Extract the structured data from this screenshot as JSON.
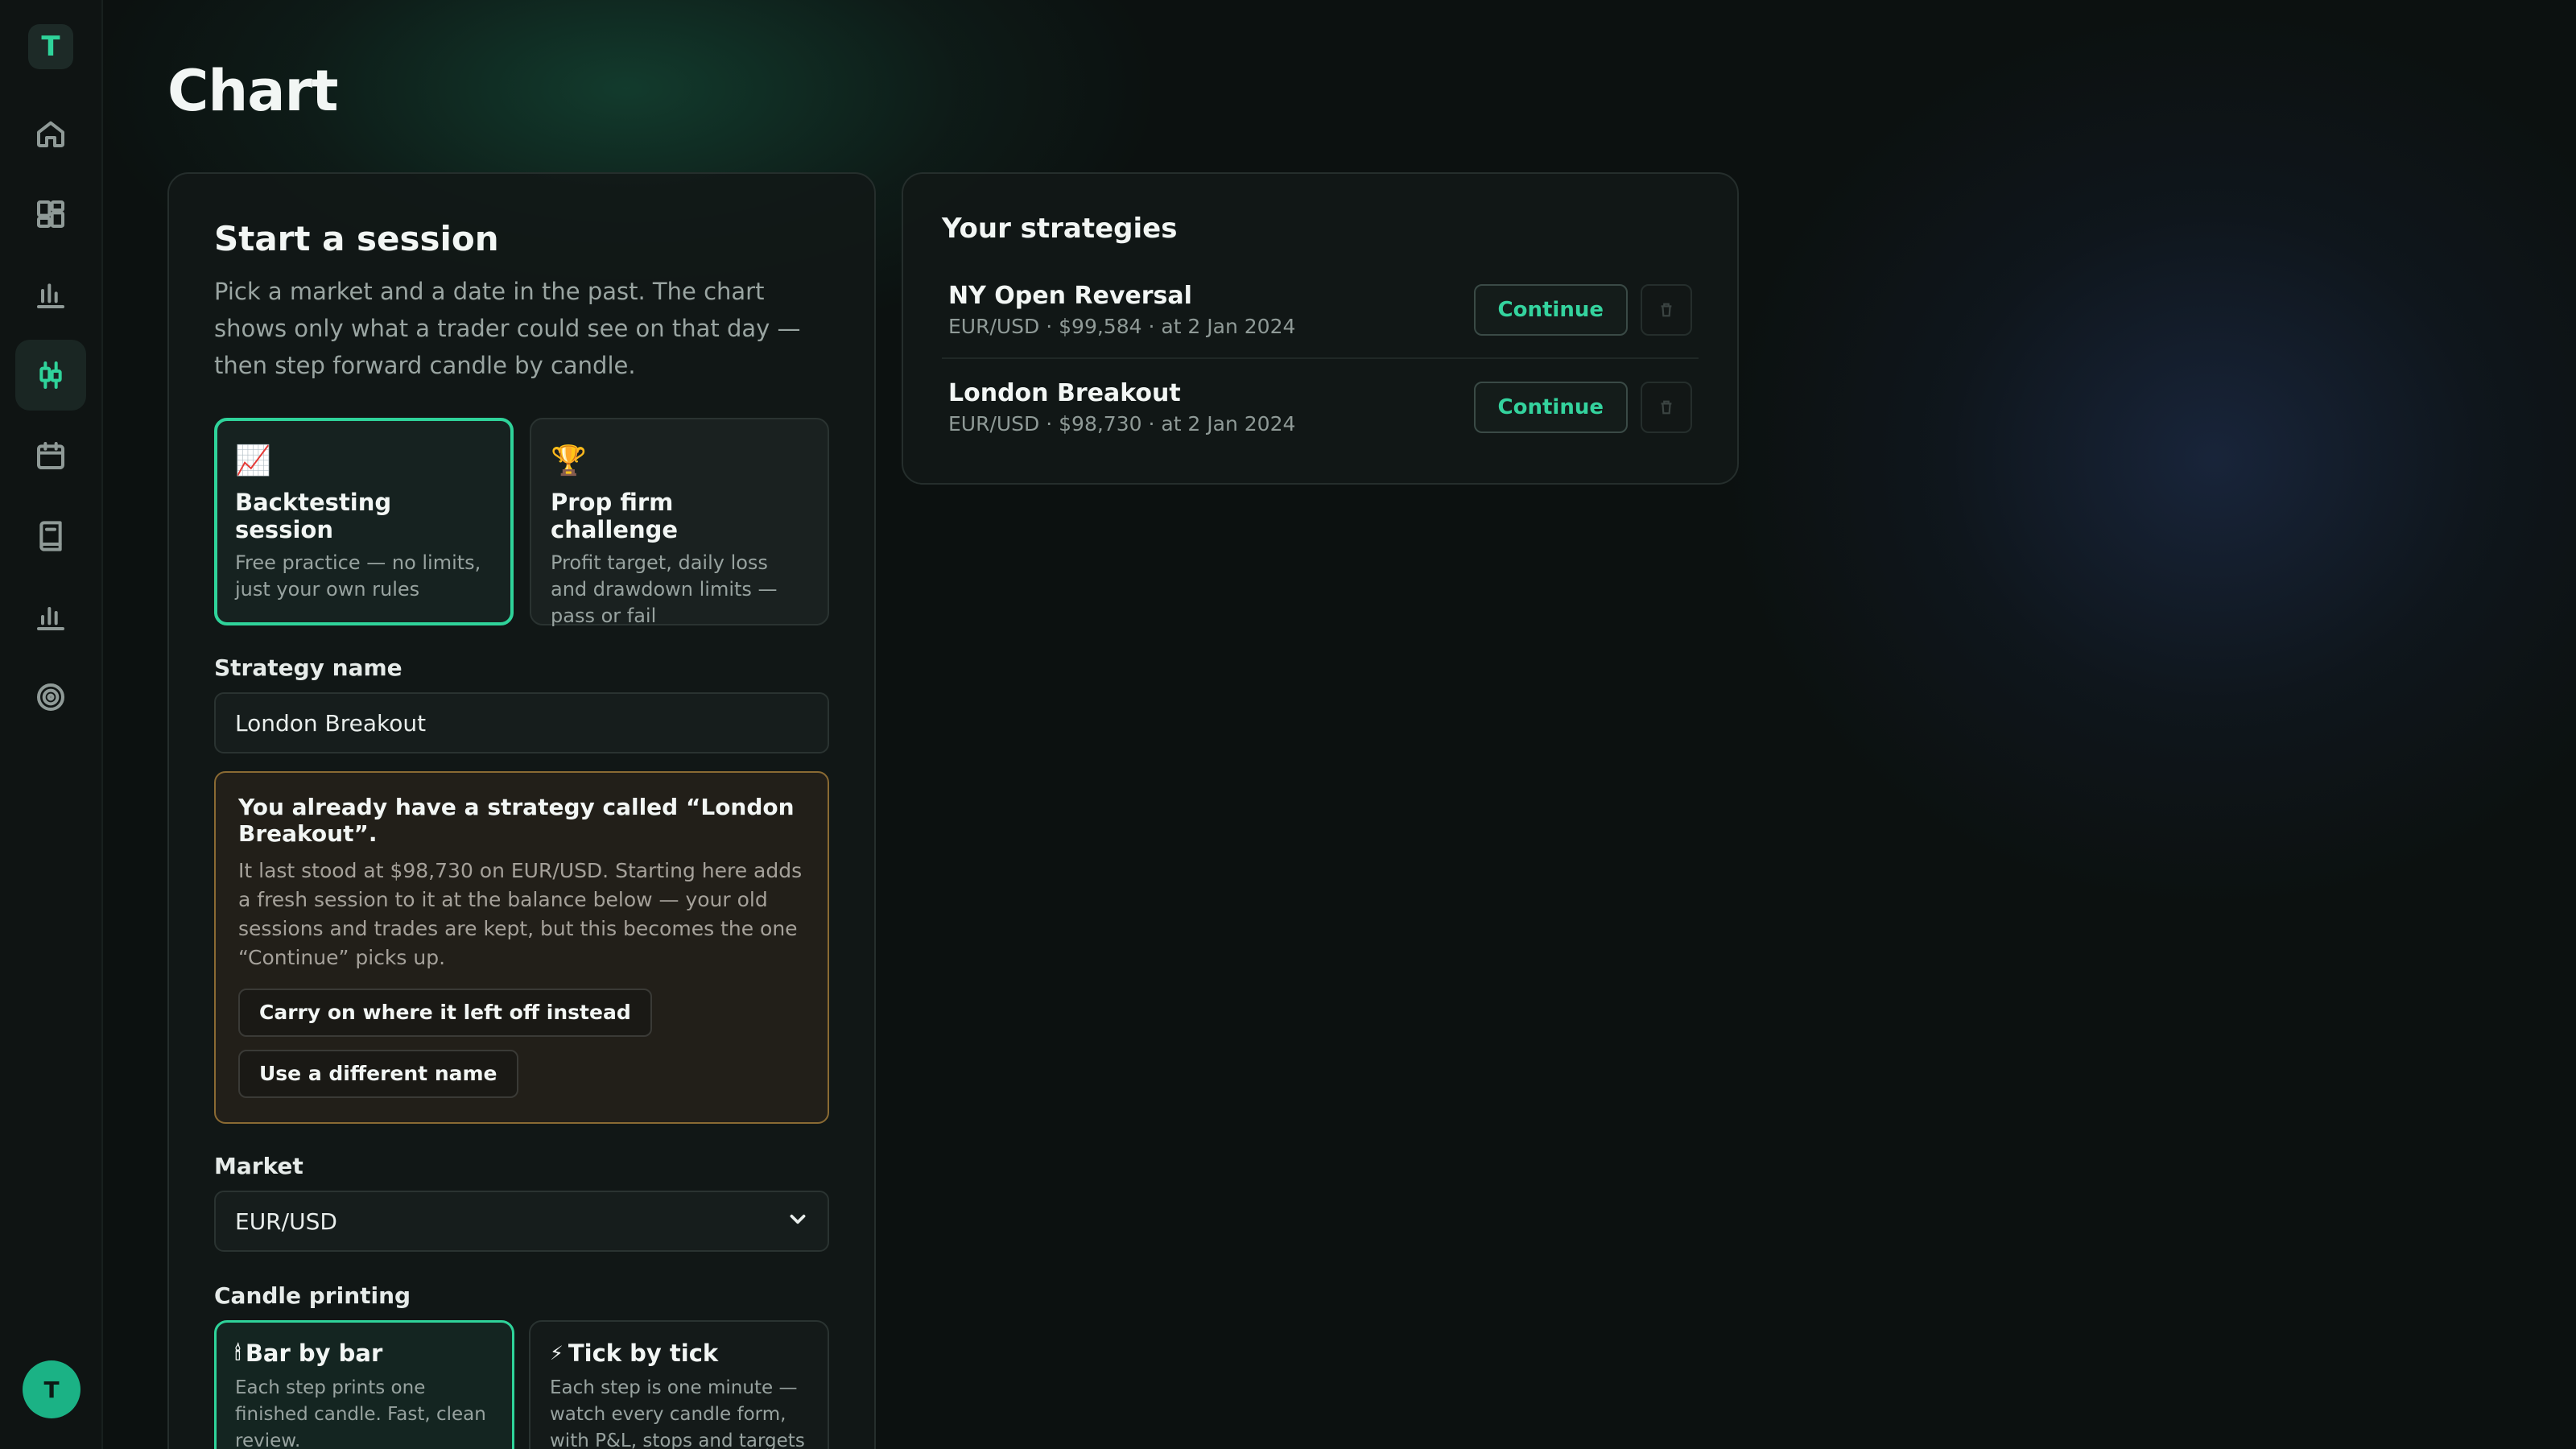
{
  "app": {
    "logo_letter": "T",
    "avatar_initial": "T"
  },
  "sidebar": {
    "items": [
      {
        "icon": "home-icon",
        "active": false
      },
      {
        "icon": "dashboard-icon",
        "active": false
      },
      {
        "icon": "bar-chart-icon",
        "active": false
      },
      {
        "icon": "candlestick-icon",
        "active": true
      },
      {
        "icon": "calendar-icon",
        "active": false
      },
      {
        "icon": "journal-icon",
        "active": false
      },
      {
        "icon": "analytics-icon",
        "active": false
      },
      {
        "icon": "target-icon",
        "active": false
      }
    ]
  },
  "page": {
    "title": "Chart"
  },
  "session": {
    "heading": "Start a session",
    "intro": "Pick a market and a date in the past. The chart shows only what a trader could see on that day — then step forward candle by candle.",
    "types": [
      {
        "icon": "📈",
        "title": "Backtesting session",
        "desc": "Free practice — no limits, just your own rules",
        "selected": true
      },
      {
        "icon": "🏆",
        "title": "Prop firm challenge",
        "desc": "Profit target, daily loss and drawdown limits — pass or fail",
        "selected": false
      }
    ],
    "strategy_label": "Strategy name",
    "strategy_value": "London Breakout",
    "warning": {
      "title": "You already have a strategy called “London Breakout”.",
      "body": "It last stood at $98,730 on EUR/USD. Starting here adds a fresh session to it at the balance below — your old sessions and trades are kept, but this becomes the one “Continue” picks up.",
      "carry_on_label": "Carry on where it left off instead",
      "different_name_label": "Use a different name"
    },
    "market_label": "Market",
    "market_value": "EUR/USD",
    "candle_label": "Candle printing",
    "printing": [
      {
        "icon": "🕯",
        "title": "Bar by bar",
        "desc": "Each step prints one finished candle. Fast, clean review.",
        "selected": true
      },
      {
        "icon": "⚡",
        "title": "Tick by tick",
        "desc": "Each step is one minute — watch every candle form, with P&L, stops and targets moving inside the bar.",
        "selected": false
      }
    ]
  },
  "strategies": {
    "heading": "Your strategies",
    "items": [
      {
        "name": "NY Open Reversal",
        "meta": "EUR/USD · $99,584 · at 2 Jan 2024",
        "continue_label": "Continue"
      },
      {
        "name": "London Breakout",
        "meta": "EUR/USD · $98,730 · at 2 Jan 2024",
        "continue_label": "Continue"
      }
    ]
  },
  "colors": {
    "accent": "#2fd39a",
    "warning_border": "#8a6a33",
    "background": "#0c1110"
  }
}
